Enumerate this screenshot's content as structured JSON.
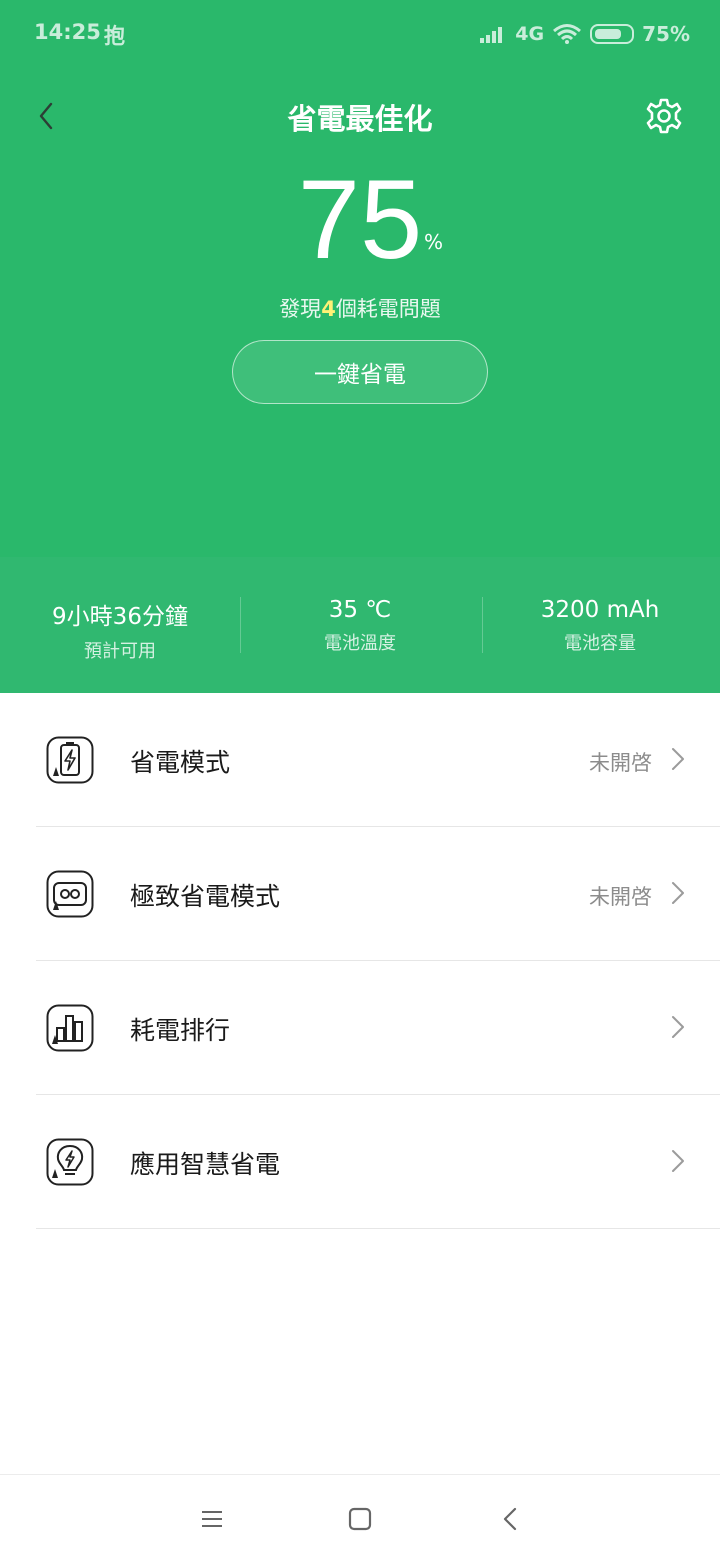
{
  "status_bar": {
    "time": "14:25",
    "app_glyph": "抱",
    "network": "4G",
    "battery": "75%",
    "battery_level": 0.75
  },
  "header": {
    "title": "省電最佳化",
    "battery_percent": "75",
    "percent_sign": "%",
    "issues_prefix": "發現",
    "issues_count": "4",
    "issues_suffix": "個耗電問題",
    "optimize_button": "一鍵省電"
  },
  "stats": [
    {
      "value": "9小時36分鐘",
      "label": "預計可用"
    },
    {
      "value": "35 ℃",
      "label": "電池溫度"
    },
    {
      "value": "3200 mAh",
      "label": "電池容量"
    }
  ],
  "menu": [
    {
      "label": "省電模式",
      "status": "未開啓",
      "icon": "battery-saver-icon"
    },
    {
      "label": "極致省電模式",
      "status": "未開啓",
      "icon": "ultra-saver-icon"
    },
    {
      "label": "耗電排行",
      "status": "",
      "icon": "power-ranking-icon"
    },
    {
      "label": "應用智慧省電",
      "status": "",
      "icon": "smart-saver-icon"
    }
  ],
  "colors": {
    "header_green": "#2ab86b",
    "stats_green": "#30b870",
    "highlight": "#fff176"
  }
}
